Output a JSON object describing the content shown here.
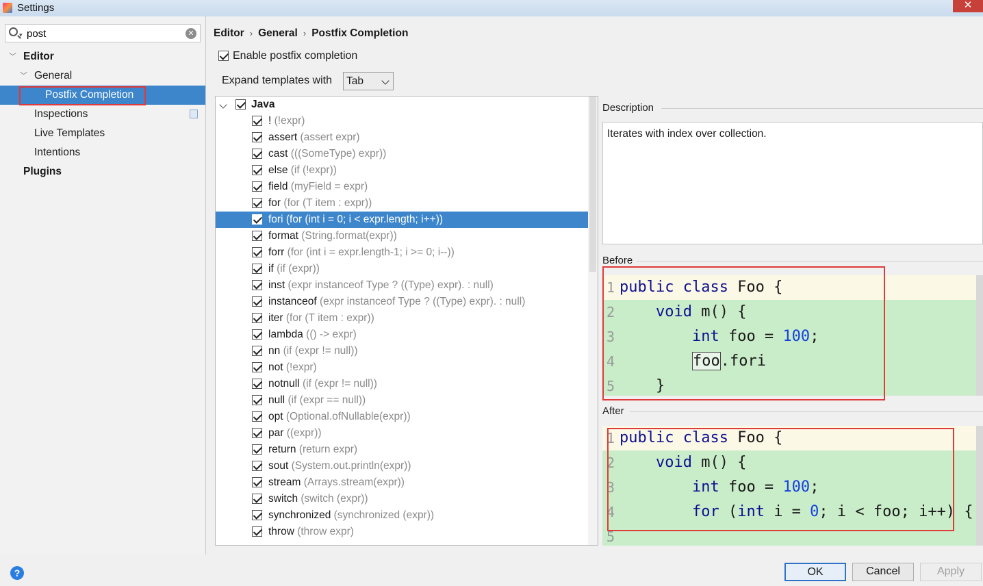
{
  "window": {
    "title": "Settings",
    "close_glyph": "✕"
  },
  "search": {
    "value": "post",
    "clear_glyph": "✕"
  },
  "tree": {
    "editor": "Editor",
    "general": "General",
    "postfix": "Postfix Completion",
    "inspections": "Inspections",
    "live_templates": "Live Templates",
    "intentions": "Intentions",
    "plugins": "Plugins"
  },
  "breadcrumb": {
    "items": [
      "Editor",
      "General",
      "Postfix Completion"
    ],
    "separator": "›"
  },
  "options": {
    "enable_label": "Enable postfix completion",
    "enable_checked": true,
    "expand_label": "Expand templates with",
    "expand_value": "Tab"
  },
  "templates": {
    "group": "Java",
    "items": [
      {
        "key": "!",
        "desc": "(!expr)"
      },
      {
        "key": "assert",
        "desc": "(assert expr)"
      },
      {
        "key": "cast",
        "desc": "(((SomeType) expr))"
      },
      {
        "key": "else",
        "desc": "(if (!expr))"
      },
      {
        "key": "field",
        "desc": "(myField = expr)"
      },
      {
        "key": "for",
        "desc": "(for (T item : expr))"
      },
      {
        "key": "fori",
        "desc": "(for (int i = 0; i < expr.length; i++))",
        "selected": true
      },
      {
        "key": "format",
        "desc": "(String.format(expr))"
      },
      {
        "key": "forr",
        "desc": "(for (int i = expr.length-1; i >= 0; i--))"
      },
      {
        "key": "if",
        "desc": "(if (expr))"
      },
      {
        "key": "inst",
        "desc": "(expr instanceof Type ? ((Type) expr). : null)"
      },
      {
        "key": "instanceof",
        "desc": "(expr instanceof Type ? ((Type) expr). : null)"
      },
      {
        "key": "iter",
        "desc": "(for (T item : expr))"
      },
      {
        "key": "lambda",
        "desc": "(() -> expr)"
      },
      {
        "key": "nn",
        "desc": "(if (expr != null))"
      },
      {
        "key": "not",
        "desc": "(!expr)"
      },
      {
        "key": "notnull",
        "desc": "(if (expr != null))"
      },
      {
        "key": "null",
        "desc": "(if (expr == null))"
      },
      {
        "key": "opt",
        "desc": "(Optional.ofNullable(expr))"
      },
      {
        "key": "par",
        "desc": "((expr))"
      },
      {
        "key": "return",
        "desc": "(return expr)"
      },
      {
        "key": "sout",
        "desc": "(System.out.println(expr))"
      },
      {
        "key": "stream",
        "desc": "(Arrays.stream(expr))"
      },
      {
        "key": "switch",
        "desc": "(switch (expr))"
      },
      {
        "key": "synchronized",
        "desc": "(synchronized (expr))"
      },
      {
        "key": "throw",
        "desc": "(throw expr)"
      }
    ]
  },
  "description": {
    "label": "Description",
    "text": "Iterates with index over collection."
  },
  "before": {
    "label": "Before",
    "lines": [
      {
        "n": "1",
        "parts": [
          [
            "kw",
            "public class "
          ],
          [
            "",
            "Foo {"
          ]
        ]
      },
      {
        "n": "2",
        "parts": [
          [
            "",
            "    "
          ],
          [
            "kw",
            "void "
          ],
          [
            "",
            "m() {"
          ]
        ]
      },
      {
        "n": "3",
        "parts": [
          [
            "",
            "        "
          ],
          [
            "kw",
            "int "
          ],
          [
            "",
            "foo = "
          ],
          [
            "num",
            "100"
          ],
          [
            "",
            ";"
          ]
        ]
      },
      {
        "n": "4",
        "parts": [
          [
            "",
            "        "
          ],
          [
            "caret",
            "foo"
          ],
          [
            "",
            ".fori"
          ]
        ]
      },
      {
        "n": "5",
        "parts": [
          [
            "",
            "    }"
          ]
        ]
      }
    ]
  },
  "after": {
    "label": "After",
    "lines": [
      {
        "n": "1",
        "parts": [
          [
            "kw",
            "public class "
          ],
          [
            "",
            "Foo {"
          ]
        ]
      },
      {
        "n": "2",
        "parts": [
          [
            "",
            "    "
          ],
          [
            "kw",
            "void "
          ],
          [
            "",
            "m() {"
          ]
        ]
      },
      {
        "n": "3",
        "parts": [
          [
            "",
            "        "
          ],
          [
            "kw",
            "int "
          ],
          [
            "",
            "foo = "
          ],
          [
            "num",
            "100"
          ],
          [
            "",
            ";"
          ]
        ]
      },
      {
        "n": "4",
        "parts": [
          [
            "",
            "        "
          ],
          [
            "kw",
            "for "
          ],
          [
            "",
            "("
          ],
          [
            "kw",
            "int "
          ],
          [
            "",
            "i = "
          ],
          [
            "num",
            "0"
          ],
          [
            "",
            "; i < foo; i++) {"
          ]
        ]
      },
      {
        "n": "5",
        "parts": [
          [
            "",
            ""
          ]
        ]
      }
    ]
  },
  "buttons": {
    "ok": "OK",
    "cancel": "Cancel",
    "apply": "Apply",
    "help": "?"
  },
  "colors": {
    "selection": "#3d86cb",
    "highlight_red": "#e03a3a",
    "code_bg": "#c9ecc9"
  }
}
